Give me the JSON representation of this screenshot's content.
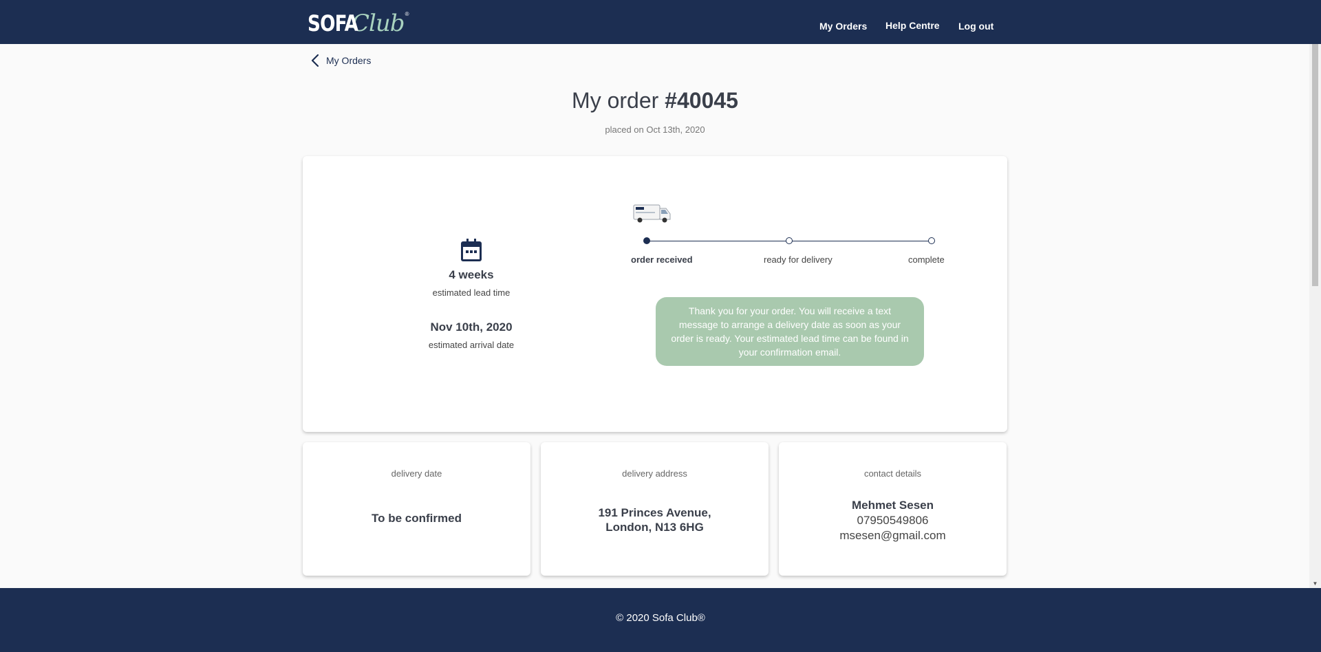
{
  "header": {
    "logo": {
      "word1": "SOFA",
      "word2": "Club",
      "reg": "®"
    },
    "nav": [
      {
        "label": "My Orders"
      },
      {
        "label": "Help Centre"
      },
      {
        "label": "Log out"
      }
    ]
  },
  "back": {
    "label": "My Orders"
  },
  "order": {
    "title_prefix": "My order ",
    "number": "#40045",
    "placed": "placed on Oct 13th, 2020"
  },
  "lead_time": {
    "value": "4 weeks",
    "label": "estimated lead time",
    "arrival_value": "Nov 10th, 2020",
    "arrival_label": "estimated arrival date"
  },
  "progress": {
    "current_step": 1,
    "steps": [
      {
        "label": "order received"
      },
      {
        "label": "ready for delivery"
      },
      {
        "label": "complete"
      }
    ]
  },
  "message": "Thank you for your order. You will receive a text message to arrange a delivery date as soon as your order is ready. Your estimated lead time can be found in your confirmation email.",
  "delivery_date": {
    "title": "delivery date",
    "value": "To be confirmed"
  },
  "delivery_address": {
    "title": "delivery address",
    "line1": "191 Princes Avenue,",
    "line2": "London, N13 6HG"
  },
  "contact": {
    "title": "contact details",
    "name": "Mehmet Sesen",
    "phone": "07950549806",
    "email": "msesen@gmail.com"
  },
  "footer": {
    "copyright": "© 2020 Sofa Club®"
  },
  "colors": {
    "brand_navy": "#1c2e52",
    "message_green": "#a9c9ae",
    "logo_mint": "#a9d2bf"
  },
  "icons": {
    "back": "chevron-left-icon",
    "calendar": "calendar-icon",
    "van": "delivery-van-icon"
  }
}
